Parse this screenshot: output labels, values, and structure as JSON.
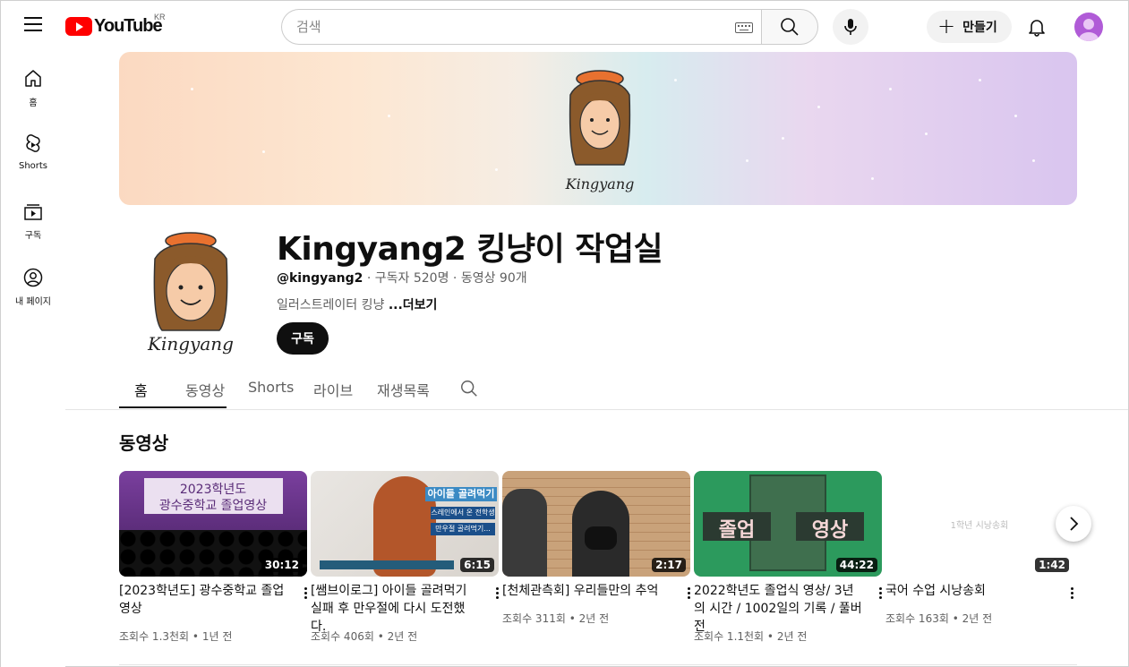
{
  "brand": {
    "logo_text": "YouTube",
    "region": "KR"
  },
  "search": {
    "placeholder": "검색"
  },
  "header": {
    "create_label": "만들기"
  },
  "sidebar": {
    "items": [
      {
        "label": "홈",
        "icon": "home-icon"
      },
      {
        "label": "Shorts",
        "icon": "shorts-icon"
      },
      {
        "label": "구독",
        "icon": "subscriptions-icon"
      },
      {
        "label": "내 페이지",
        "icon": "you-icon"
      }
    ]
  },
  "channel": {
    "name": "Kingyang2 킹냥이 작업실",
    "handle": "@kingyang2",
    "subscribers": "구독자 520명",
    "videos_count": "동영상 90개",
    "description": "일러스트레이터 킹냥 ",
    "more_label": "...더보기",
    "subscribe_label": "구독",
    "avatar_signature": "Kingyang"
  },
  "tabs": [
    {
      "label": "홈",
      "active": true
    },
    {
      "label": "동영상",
      "active": false
    },
    {
      "label": "Shorts",
      "active": false
    },
    {
      "label": "라이브",
      "active": false
    },
    {
      "label": "재생목록",
      "active": false
    }
  ],
  "section": {
    "title": "동영상"
  },
  "videos": [
    {
      "title": "[2023학년도] 광수중학교 졸업영상",
      "views": "조회수 1.3천회",
      "age": "1년 전",
      "duration": "30:12",
      "thumb_text_1": "2023학년도",
      "thumb_text_2": "광수중학교 졸업영상"
    },
    {
      "title": "[쌤브이로그] 아이들 골려먹기 실패 후 만우절에 다시 도전했다.",
      "views": "조회수 406회",
      "age": "2년 전",
      "duration": "6:15",
      "thumb_text_1": "아이들 골려먹기",
      "thumb_text_2": "스레인에서 온 전학생",
      "thumb_text_3": "만우절 골려먹기..."
    },
    {
      "title": "[천체관측회] 우리들만의 추억",
      "views": "조회수 311회",
      "age": "2년 전",
      "duration": "2:17"
    },
    {
      "title": "2022학년도 졸업식 영상/ 3년의 시간 / 1002일의 기록 / 풀버전",
      "views": "조회수 1.1천회",
      "age": "2년 전",
      "duration": "44:22",
      "thumb_text_1": "졸업",
      "thumb_text_2": "영상"
    },
    {
      "title": "국어 수업 시낭송회",
      "views": "조회수 163회",
      "age": "2년 전",
      "duration": "1:42",
      "thumb_text_1": "1학년 시낭송회"
    }
  ],
  "colors": {
    "brand_red": "#ff0000",
    "text_primary": "#0f0f0f",
    "text_secondary": "#606060",
    "avatar_purple": "#b05bd7"
  }
}
